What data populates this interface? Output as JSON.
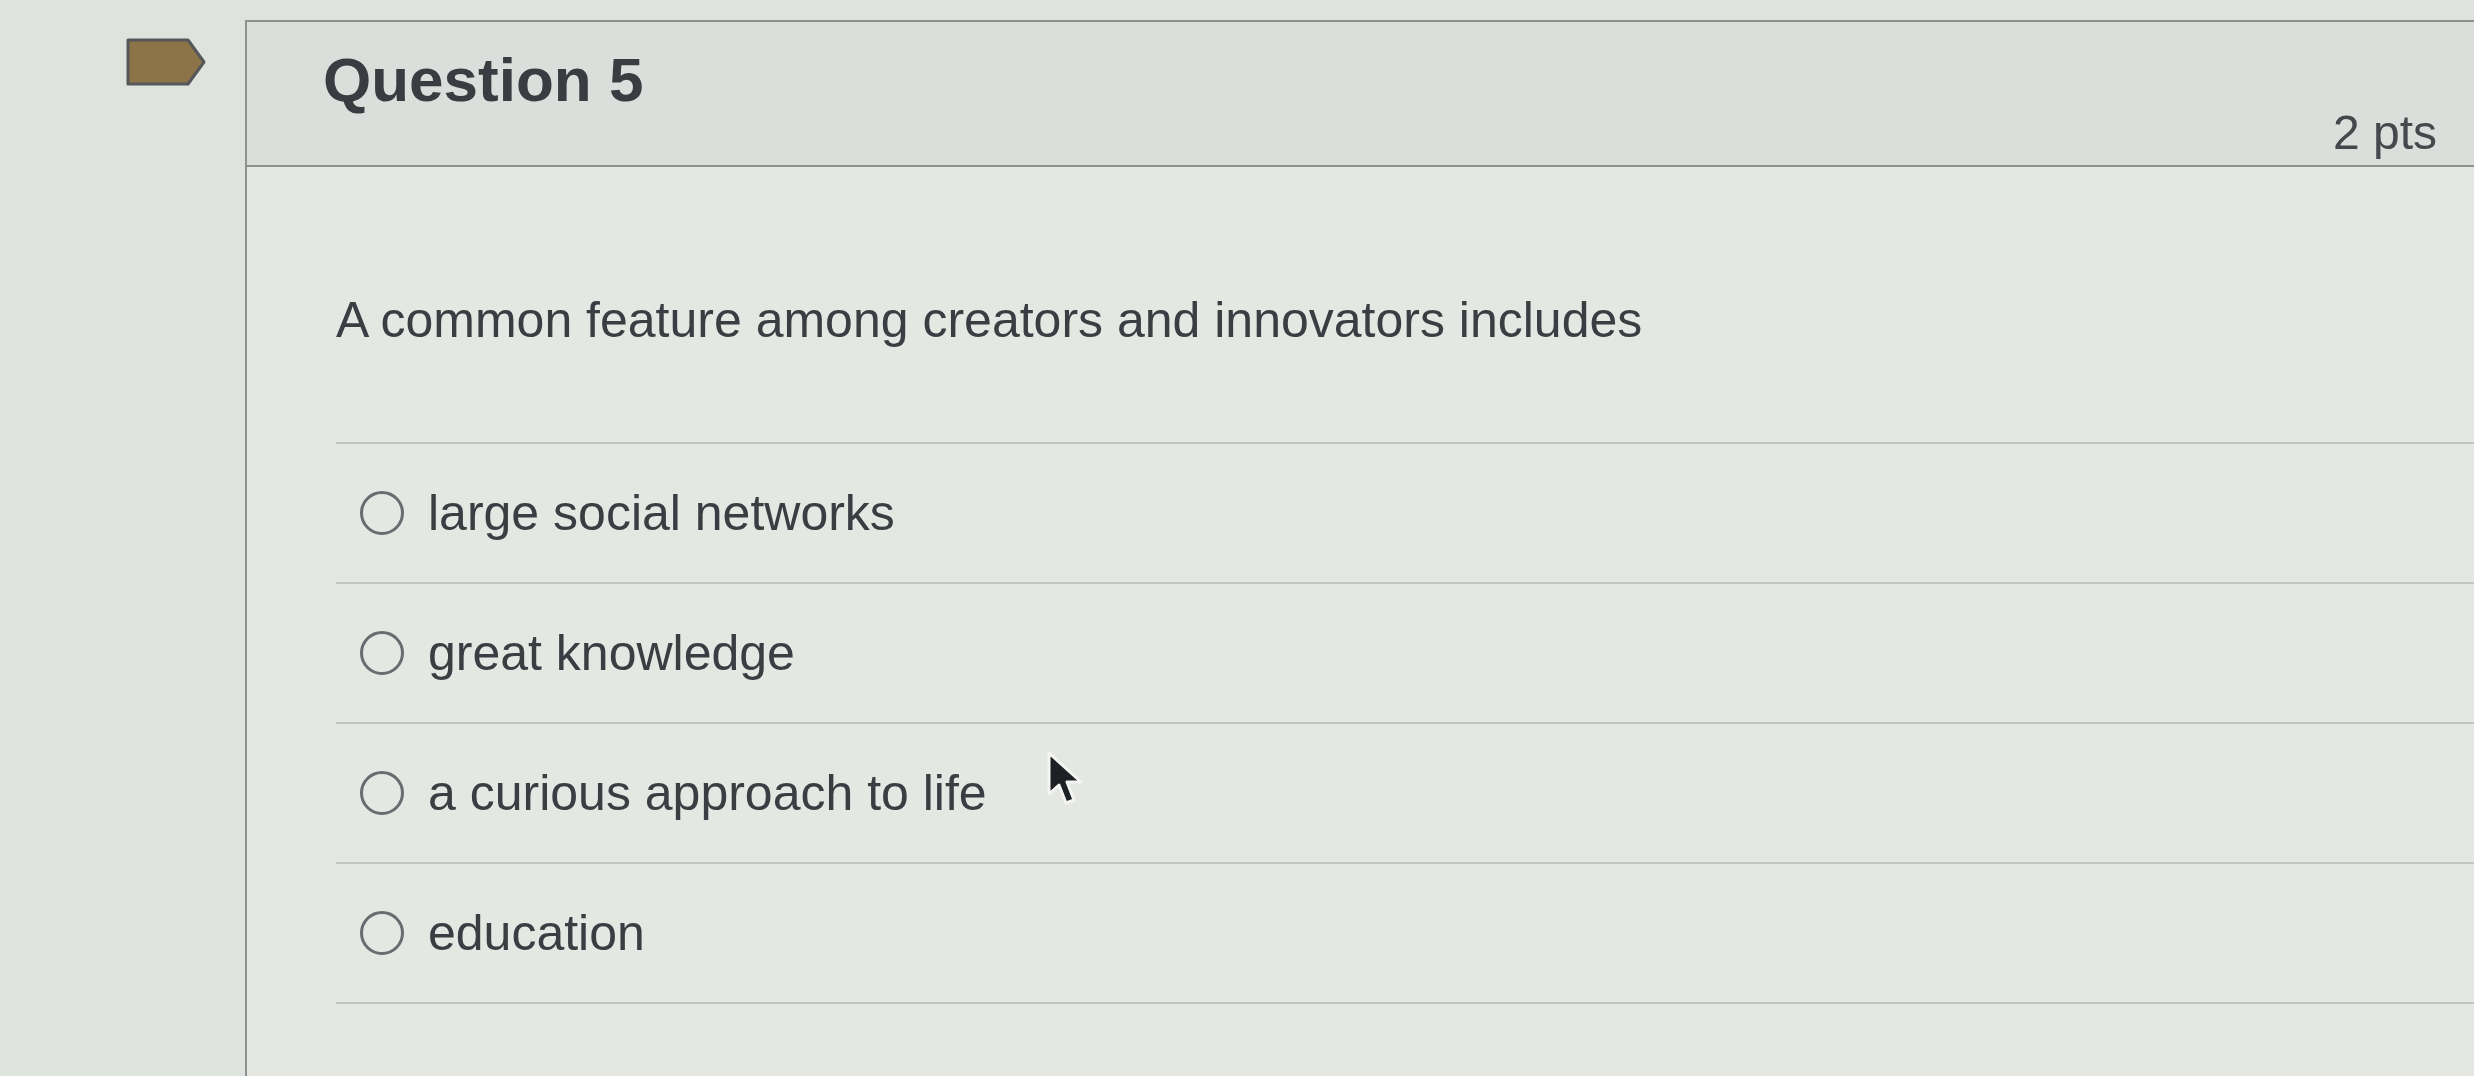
{
  "question": {
    "title": "Question 5",
    "points": "2 pts",
    "text": "A common feature among creators and innovators includes",
    "options": [
      {
        "label": "large social networks",
        "selected": false
      },
      {
        "label": "great knowledge",
        "selected": false
      },
      {
        "label": "a curious approach to life",
        "selected": false
      },
      {
        "label": "education",
        "selected": false
      }
    ]
  }
}
